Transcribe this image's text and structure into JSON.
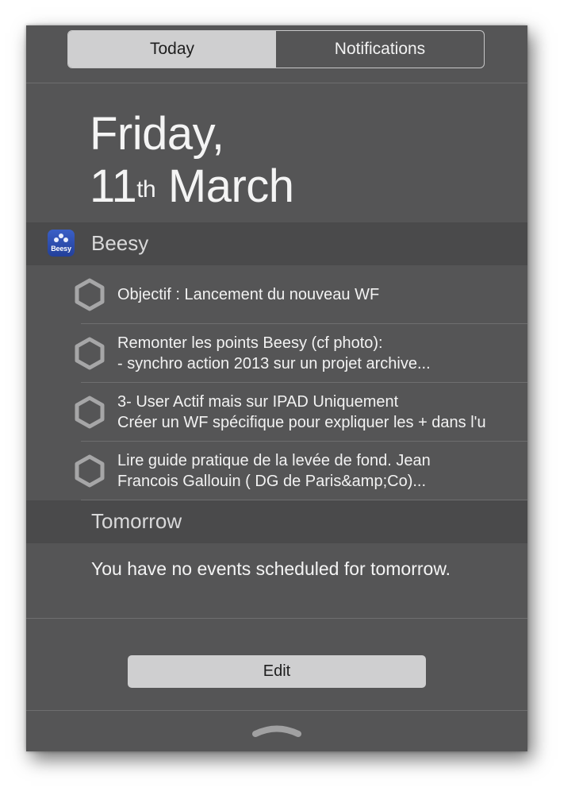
{
  "tabs": [
    {
      "label": "Today",
      "active": true
    },
    {
      "label": "Notifications",
      "active": false
    }
  ],
  "date": {
    "line1": "Friday,",
    "day": "11",
    "suffix": "th",
    "month": "March"
  },
  "beesy": {
    "app_name": "Beesy",
    "icon_text": "Beesy",
    "items": [
      {
        "line1": "Objectif : Lancement du nouveau WF",
        "line2": ""
      },
      {
        "line1": "Remonter les points Beesy (cf photo):",
        "line2": "- synchro action 2013 sur un projet archive..."
      },
      {
        "line1": "3- User Actif mais sur IPAD Uniquement",
        "line2": "Créer un WF spécifique pour expliquer les + dans l'u"
      },
      {
        "line1": "Lire  guide pratique de la levée de fond. Jean",
        "line2": "Francois Gallouin ( DG de Paris&amp;Co)..."
      }
    ]
  },
  "tomorrow": {
    "title": "Tomorrow",
    "message": "You have no events scheduled for tomorrow."
  },
  "edit_label": "Edit",
  "colors": {
    "panel": "#555556",
    "band": "#4a4a4b",
    "segment_active": "#cfcfd0",
    "icon_blue": "#2f4fb4"
  },
  "icons": {
    "task_status": "hexagon-outline-icon",
    "collapse_handle": "chevron-up-handle-icon"
  }
}
